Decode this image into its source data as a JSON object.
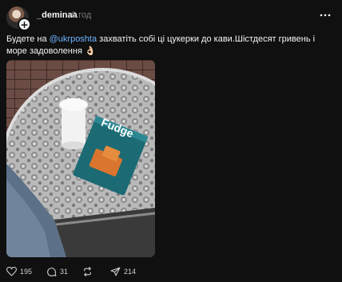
{
  "post": {
    "author": {
      "username": "_deminaa",
      "time_ago": "6 год",
      "follow_icon": "plus-icon"
    },
    "caption": {
      "before": "Будете на ",
      "mention": "@ukrposhta",
      "after": " захватіть собі ці цукерки до кави.Шістдесят гривень і море задоволення 👌🏻"
    },
    "image": {
      "product_text": "Fudge"
    },
    "actions": {
      "likes": "195",
      "comments": "31",
      "shares": "214"
    },
    "colors": {
      "background": "#101010",
      "text": "#f3f5f7",
      "muted": "#777777",
      "mention": "#6db6ff"
    }
  }
}
